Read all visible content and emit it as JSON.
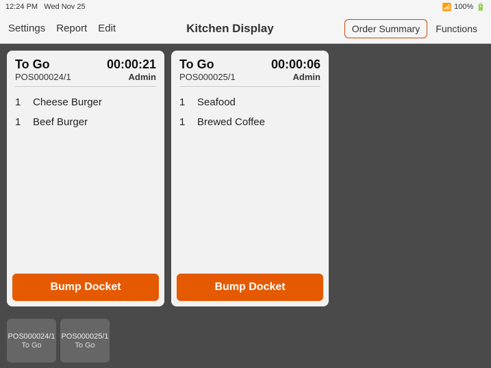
{
  "statusBar": {
    "time": "12:24 PM",
    "day": "Wed Nov 25",
    "wifi": "wifi",
    "battery": "100%"
  },
  "navBar": {
    "settings": "Settings",
    "report": "Report",
    "edit": "Edit",
    "title": "Kitchen Display",
    "orderSummary": "Order Summary",
    "functions": "Functions"
  },
  "orders": [
    {
      "id": "order-1",
      "title": "To Go",
      "timer": "00:00:21",
      "pos": "POS000024/1",
      "admin": "Admin",
      "items": [
        {
          "qty": "1",
          "name": "Cheese Burger"
        },
        {
          "qty": "1",
          "name": "Beef Burger"
        }
      ],
      "bumpLabel": "Bump Docket"
    },
    {
      "id": "order-2",
      "title": "To Go",
      "timer": "00:00:06",
      "pos": "POS000025/1",
      "admin": "Admin",
      "items": [
        {
          "qty": "1",
          "name": "Seafood"
        },
        {
          "qty": "1",
          "name": "Brewed Coffee"
        }
      ],
      "bumpLabel": "Bump Docket"
    }
  ],
  "thumbnails": [
    {
      "pos": "POS000024/1",
      "type": "To Go"
    },
    {
      "pos": "POS000025/1",
      "type": "To Go"
    }
  ]
}
